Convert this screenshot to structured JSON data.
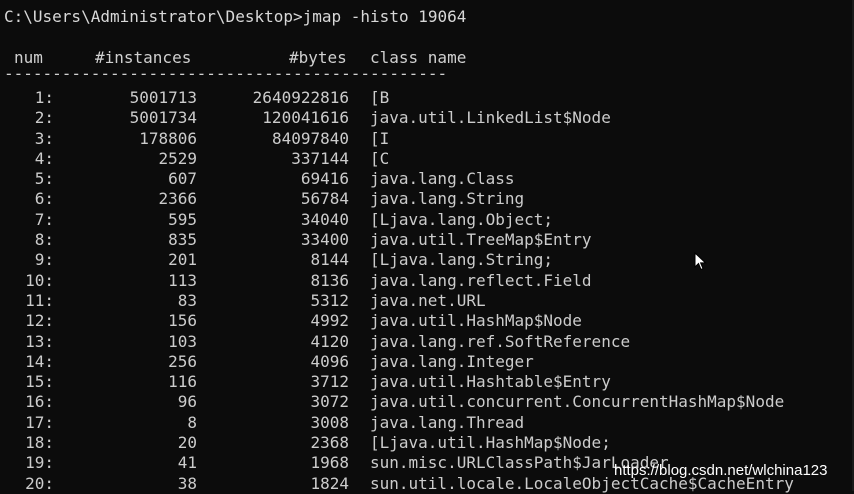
{
  "terminal": {
    "prompt": "C:\\Users\\Administrator\\Desktop>jmap -histo 19064",
    "headers": {
      "num": "num",
      "instances": "#instances",
      "bytes": "#bytes",
      "class_name": "class name"
    },
    "separator": "----------------------------------------------",
    "rows": [
      {
        "num": "1:",
        "instances": "5001713",
        "bytes": "2640922816",
        "class": "[B"
      },
      {
        "num": "2:",
        "instances": "5001734",
        "bytes": "120041616",
        "class": "java.util.LinkedList$Node"
      },
      {
        "num": "3:",
        "instances": "178806",
        "bytes": "84097840",
        "class": "[I"
      },
      {
        "num": "4:",
        "instances": "2529",
        "bytes": "337144",
        "class": "[C"
      },
      {
        "num": "5:",
        "instances": "607",
        "bytes": "69416",
        "class": "java.lang.Class"
      },
      {
        "num": "6:",
        "instances": "2366",
        "bytes": "56784",
        "class": "java.lang.String"
      },
      {
        "num": "7:",
        "instances": "595",
        "bytes": "34040",
        "class": "[Ljava.lang.Object;"
      },
      {
        "num": "8:",
        "instances": "835",
        "bytes": "33400",
        "class": "java.util.TreeMap$Entry"
      },
      {
        "num": "9:",
        "instances": "201",
        "bytes": "8144",
        "class": "[Ljava.lang.String;"
      },
      {
        "num": "10:",
        "instances": "113",
        "bytes": "8136",
        "class": "java.lang.reflect.Field"
      },
      {
        "num": "11:",
        "instances": "83",
        "bytes": "5312",
        "class": "java.net.URL"
      },
      {
        "num": "12:",
        "instances": "156",
        "bytes": "4992",
        "class": "java.util.HashMap$Node"
      },
      {
        "num": "13:",
        "instances": "103",
        "bytes": "4120",
        "class": "java.lang.ref.SoftReference"
      },
      {
        "num": "14:",
        "instances": "256",
        "bytes": "4096",
        "class": "java.lang.Integer"
      },
      {
        "num": "15:",
        "instances": "116",
        "bytes": "3712",
        "class": "java.util.Hashtable$Entry"
      },
      {
        "num": "16:",
        "instances": "96",
        "bytes": "3072",
        "class": "java.util.concurrent.ConcurrentHashMap$Node"
      },
      {
        "num": "17:",
        "instances": "8",
        "bytes": "3008",
        "class": "java.lang.Thread"
      },
      {
        "num": "18:",
        "instances": "20",
        "bytes": "2368",
        "class": "[Ljava.util.HashMap$Node;"
      },
      {
        "num": "19:",
        "instances": "41",
        "bytes": "1968",
        "class": "sun.misc.URLClassPath$JarLoader"
      },
      {
        "num": "20:",
        "instances": "38",
        "bytes": "1824",
        "class": "sun.util.locale.LocaleObjectCache$CacheEntry"
      }
    ]
  },
  "watermark": "https://blog.csdn.net/wlchina123",
  "colors": {
    "background": "#0c0c0c",
    "text": "#cccccc"
  }
}
